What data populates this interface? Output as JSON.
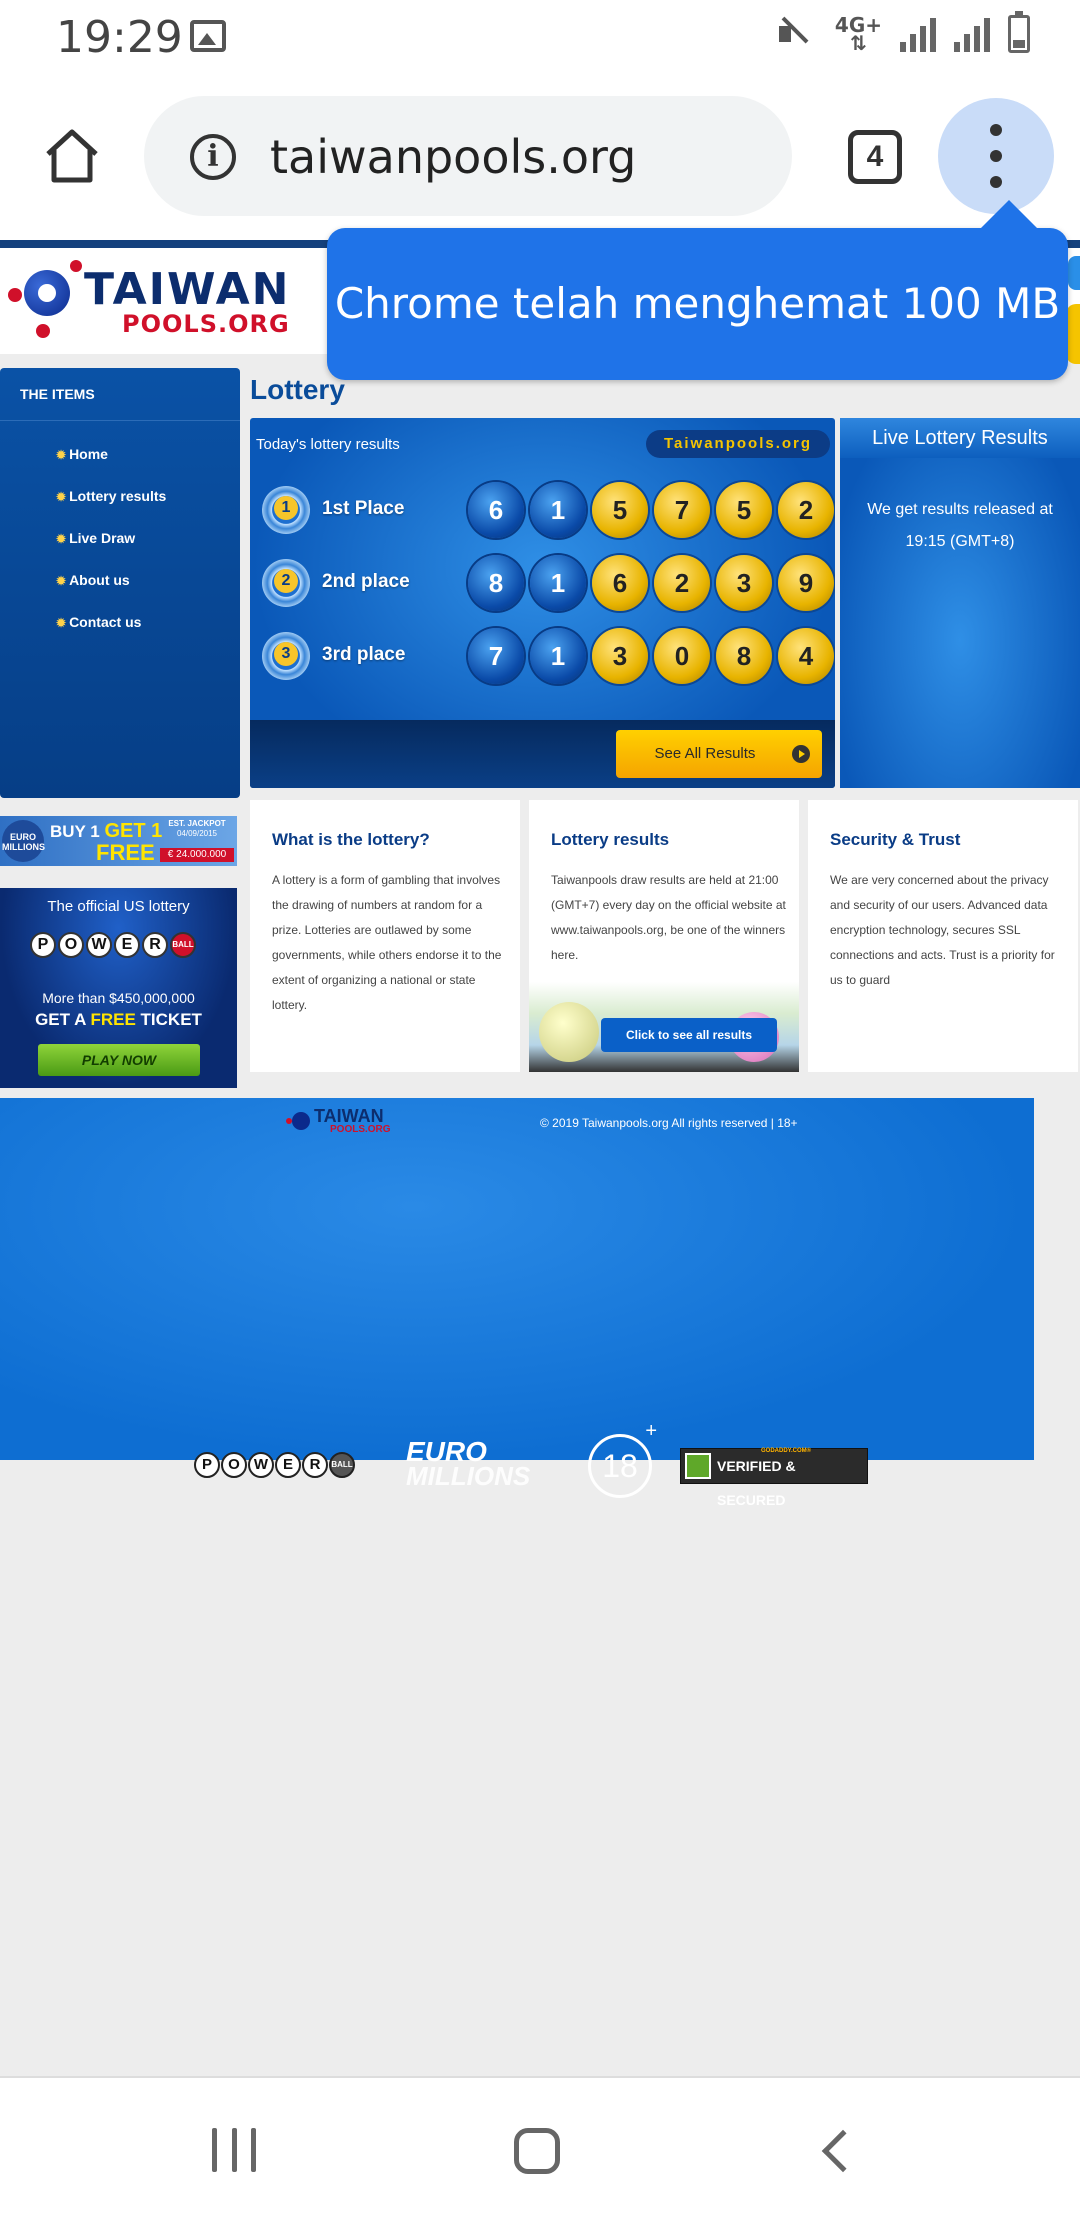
{
  "status_bar": {
    "time": "19:29",
    "network": "4G+",
    "icons": [
      "image-icon",
      "mute-icon",
      "network-4g-icon",
      "signal-icon",
      "signal-icon",
      "battery-charging-icon"
    ]
  },
  "browser": {
    "url": "taiwanpools.org",
    "tab_count": "4",
    "toast": "Chrome telah menghemat 100 MB"
  },
  "site": {
    "logo_line1": "TAIWAN",
    "logo_line2": "POOLS.ORG",
    "sidebar": {
      "heading": "THE ITEMS",
      "items": [
        {
          "label": "Home"
        },
        {
          "label": "Lottery results"
        },
        {
          "label": "Live Draw"
        },
        {
          "label": "About us"
        },
        {
          "label": "Contact us"
        }
      ]
    },
    "page_title": "Lottery",
    "results": {
      "heading": "Today's lottery results",
      "brand": "Taiwanpools.org",
      "places": [
        {
          "badge": "1",
          "label": "1st Place",
          "numbers": [
            "6",
            "1",
            "5",
            "7",
            "5",
            "2"
          ]
        },
        {
          "badge": "2",
          "label": "2nd place",
          "numbers": [
            "8",
            "1",
            "6",
            "2",
            "3",
            "9"
          ]
        },
        {
          "badge": "3",
          "label": "3rd place",
          "numbers": [
            "7",
            "1",
            "3",
            "0",
            "8",
            "4"
          ]
        }
      ],
      "see_all_label": "See All Results"
    },
    "live": {
      "heading": "Live Lottery Results",
      "body": "We get results released at 19:15 (GMT+8)"
    },
    "ads": {
      "euro": {
        "badge": "EURO MILLIONS",
        "line1_a": "BUY 1 ",
        "line1_b": "GET 1",
        "line2": "FREE",
        "jackpot_label": "EST. JACKPOT",
        "jackpot_date": "04/09/2015",
        "jackpot_amount": "€ 24.000.000"
      },
      "powerball": {
        "line1": "The official US lottery",
        "letters": [
          "P",
          "O",
          "W",
          "E",
          "R"
        ],
        "ball_word": "BALL",
        "line2": "More than $450,000,000",
        "line3_a": "GET A ",
        "line3_b": "FREE",
        "line3_c": " TICKET",
        "cta": "PLAY NOW"
      }
    },
    "cards": [
      {
        "title": "What is the lottery?",
        "body": "A lottery is a form of gambling that involves the drawing of numbers at random for a prize. Lotteries are outlawed by some governments, while others endorse it to the extent of organizing a national or state lottery."
      },
      {
        "title": "Lottery results",
        "body": "Taiwanpools draw results are held at 21:00 (GMT+7) every day on the official website at www.taiwanpools.org, be one of the winners here.",
        "button": "Click to see all results"
      },
      {
        "title": "Security & Trust",
        "body": "We are very concerned about the privacy and security of our users. Advanced data encryption technology, secures SSL connections and acts. Trust is a priority for us to guard"
      }
    ],
    "footer": {
      "copyright": "© 2019 Taiwanpools.org All rights reserved | 18+",
      "logos": {
        "powerball_letters": [
          "P",
          "O",
          "W",
          "E",
          "R"
        ],
        "powerball_ball": "BALL",
        "euro_line1": "EURO",
        "euro_line2": "MILLIONS",
        "age": "18",
        "age_plus": "+",
        "verified": "VERIFIED & SECURED",
        "verified_small": "GODADDY.COM®"
      }
    }
  },
  "colors": {
    "chrome_blue": "#1f73e8",
    "site_blue": "#0a52a6",
    "gold_ball": "#e8b400",
    "blue_ball": "#0a4aa8"
  }
}
